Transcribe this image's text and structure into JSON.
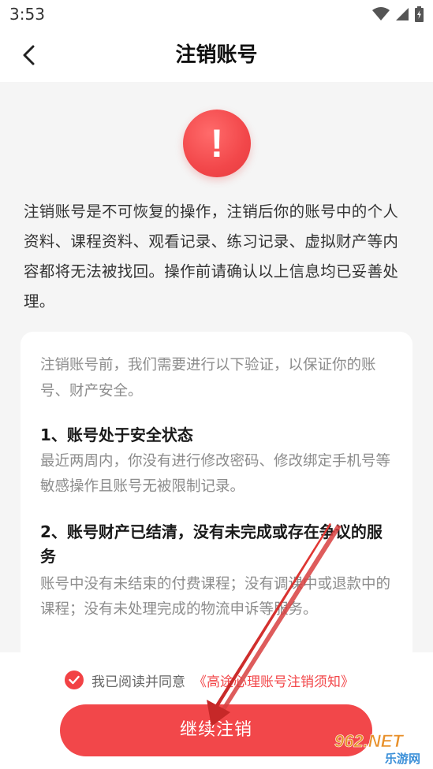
{
  "status_bar": {
    "time": "3:53",
    "icons": [
      "wifi-icon",
      "signal-icon",
      "battery-icon"
    ]
  },
  "header": {
    "title": "注销账号",
    "back_icon": "chevron-left-icon"
  },
  "warning_icon": {
    "icon": "exclamation-icon",
    "glyph": "!",
    "color": "#f2474a"
  },
  "intro_text": "注销账号是不可恢复的操作，注销后你的账号中的个人资料、课程资料、观看记录、练习记录、虚拟财产等内容都将无法被找回。操作前请确认以上信息均已妥善处理。",
  "card": {
    "intro": "注销账号前，我们需要进行以下验证，以保证你的账号、财产安全。",
    "requirements": [
      {
        "title": "1、账号处于安全状态",
        "desc": "最近两周内，你没有进行修改密码、修改绑定手机号等敏感操作且账号无被限制记录。"
      },
      {
        "title": "2、账号财产已结清，没有未完成或存在争议的服务",
        "desc": "账号中没有未结束的付费课程；没有调课中或退款中的课程；没有未处理完成的物流申诉等服务。"
      }
    ]
  },
  "agreement": {
    "checked": true,
    "text": "我已阅读并同意",
    "link": "《高途心理账号注销须知》"
  },
  "primary_button": {
    "label": "继续注销"
  },
  "watermark": {
    "top": "962.NET",
    "bottom": "乐游网"
  },
  "colors": {
    "accent": "#f2474a",
    "background": "#f5f5f5",
    "arrow": "#d32f2f"
  }
}
